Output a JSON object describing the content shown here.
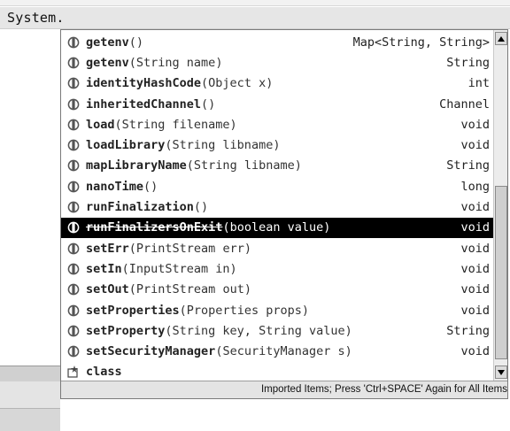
{
  "editor": {
    "text": "System."
  },
  "completion": {
    "items": [
      {
        "name": "getenv",
        "params": "()",
        "ret": "Map<String, String>",
        "icon": "method-icon"
      },
      {
        "name": "getenv",
        "params": "(String name)",
        "ret": "String",
        "icon": "method-icon"
      },
      {
        "name": "identityHashCode",
        "params": "(Object x)",
        "ret": "int",
        "icon": "method-icon"
      },
      {
        "name": "inheritedChannel",
        "params": "()",
        "ret": "Channel",
        "icon": "method-icon"
      },
      {
        "name": "load",
        "params": "(String filename)",
        "ret": "void",
        "icon": "method-icon"
      },
      {
        "name": "loadLibrary",
        "params": "(String libname)",
        "ret": "void",
        "icon": "method-icon"
      },
      {
        "name": "mapLibraryName",
        "params": "(String libname)",
        "ret": "String",
        "icon": "method-icon"
      },
      {
        "name": "nanoTime",
        "params": "()",
        "ret": "long",
        "icon": "method-icon"
      },
      {
        "name": "runFinalization",
        "params": "()",
        "ret": "void",
        "icon": "method-icon"
      },
      {
        "name": "runFinalizersOnExit",
        "params": "(boolean value)",
        "ret": "void",
        "icon": "method-icon",
        "selected": true,
        "deprecated": true
      },
      {
        "name": "setErr",
        "params": "(PrintStream err)",
        "ret": "void",
        "icon": "method-icon"
      },
      {
        "name": "setIn",
        "params": "(InputStream in)",
        "ret": "void",
        "icon": "method-icon"
      },
      {
        "name": "setOut",
        "params": "(PrintStream out)",
        "ret": "void",
        "icon": "method-icon"
      },
      {
        "name": "setProperties",
        "params": "(Properties props)",
        "ret": "void",
        "icon": "method-icon"
      },
      {
        "name": "setProperty",
        "params": "(String key, String value)",
        "ret": "String",
        "icon": "method-icon"
      },
      {
        "name": "setSecurityManager",
        "params": "(SecurityManager s)",
        "ret": "void",
        "icon": "method-icon"
      },
      {
        "name": "class",
        "params": "",
        "ret": "",
        "icon": "keyword-icon"
      }
    ],
    "status": "Imported Items; Press 'Ctrl+SPACE' Again for All Items"
  },
  "colors": {
    "selection_bg": "#000000",
    "selection_fg": "#ffffff",
    "status_bg": "#e4e4e4"
  }
}
